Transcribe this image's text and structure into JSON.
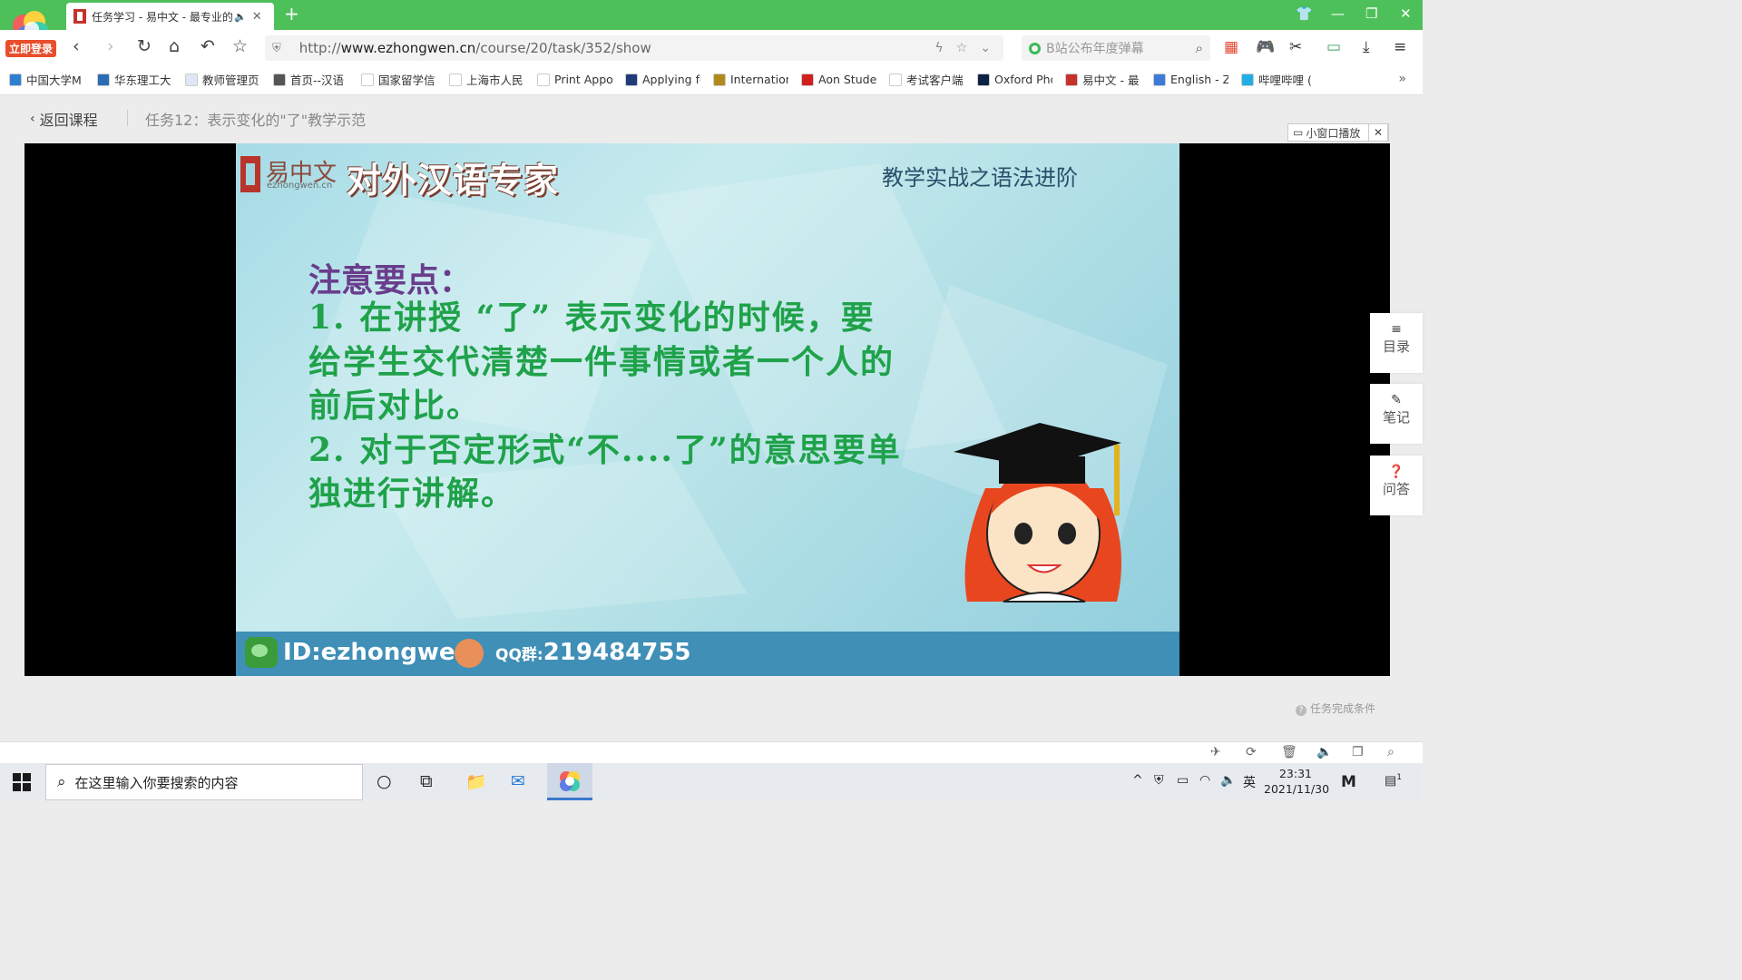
{
  "browser": {
    "login_badge": "立即登录",
    "tab_title": "任务学习 - 易中文 - 最专业的",
    "url_host": "www.ezhongwen.cn",
    "url_prefix": "http://",
    "url_path": "/course/20/task/352/show",
    "search_placeholder": "B站公布年度弹幕"
  },
  "bookmarks": [
    {
      "label": "中国大学M",
      "color": "#2f7fd1"
    },
    {
      "label": "华东理工大",
      "color": "#2a6db5"
    },
    {
      "label": "教师管理页",
      "color": "#dfe6f5"
    },
    {
      "label": "首页--汉语",
      "color": "#555555"
    },
    {
      "label": "国家留学信",
      "color": "#ffffff"
    },
    {
      "label": "上海市人民",
      "color": "#ffffff"
    },
    {
      "label": "Print Appo",
      "color": "#ffffff"
    },
    {
      "label": "Applying fo",
      "color": "#1f3b7a"
    },
    {
      "label": "Internation",
      "color": "#b08a1a"
    },
    {
      "label": "Aon Studen",
      "color": "#d2201c"
    },
    {
      "label": "考试客户端",
      "color": "#ffffff"
    },
    {
      "label": "Oxford Pho",
      "color": "#0c2244"
    },
    {
      "label": "易中文 - 最",
      "color": "#c5322b"
    },
    {
      "label": "English - Z",
      "color": "#3d7bd9"
    },
    {
      "label": "哔哩哔哩 (",
      "color": "#23ade5"
    }
  ],
  "page": {
    "back_label": "返回课程",
    "task_title": "任务12：表示变化的\"了\"教学示范",
    "mini_player_label": "小窗口播放",
    "complete_label": "任务完成条件"
  },
  "slide": {
    "brand_cn": "易中文",
    "brand_domain": "ezhongwen.cn",
    "brand_slogan": "对外汉语专家",
    "subtitle": "教学实战之语法进阶",
    "heading": "注意要点：",
    "lines": [
      "1. 在讲授 “了” 表示变化的时候，要",
      "给学生交代清楚一件事情或者一个人的",
      "前后对比。",
      "2. 对于否定形式“不....了”的意思要单",
      "独进行讲解。"
    ],
    "wechat_id": "ID:ezhongwen",
    "qq_prefix": "QQ群:",
    "qq_number": "219484755"
  },
  "sidebar": {
    "catalog": "目录",
    "notes": "笔记",
    "qa": "问答"
  },
  "taskbar": {
    "search_placeholder": "在这里输入你要搜索的内容",
    "ime": "英",
    "time": "23:31",
    "date": "2021/11/30",
    "notification_count": "1"
  }
}
